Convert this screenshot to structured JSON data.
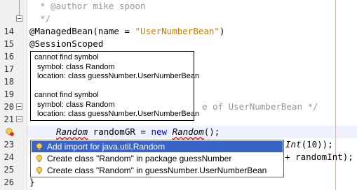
{
  "gutter": {
    "line_numbers": [
      "14",
      "15",
      "16",
      "17",
      "18",
      "19",
      "20",
      "21",
      "22",
      "23",
      "24",
      "25",
      "26"
    ]
  },
  "code": {
    "line_12": "* @author mike spoon",
    "line_13": "*/",
    "line_14_annotation": "@ManagedBean",
    "line_14_mid": "(name = ",
    "line_14_string": "\"UserNumberBean\"",
    "line_14_end": ")",
    "line_15": "@SessionScoped",
    "line_20_tail": "e of UserNumberBean */",
    "line_22_type": "Random",
    "line_22_var": " randomGR = ",
    "line_22_new": "new",
    "line_22_ctor": "Random",
    "line_22_end": "();",
    "line_23_tail_italic": "Int",
    "line_23_tail": "(10));",
    "line_24_tail": "+ randomInt);",
    "line_26": "}"
  },
  "tooltip": {
    "error1_title": "cannot find symbol",
    "error1_symbol": "symbol:   class Random",
    "error1_location": "location: class guessNumber.UserNumberBean",
    "error2_title": "cannot find symbol",
    "error2_symbol": "symbol:   class Random",
    "error2_location": "location: class guessNumber.UserNumberBean"
  },
  "hint_popup": {
    "items": [
      {
        "label": "Add import for java.util.Random"
      },
      {
        "label": "Create class \"Random\" in package guessNumber"
      },
      {
        "label": "Create class \"Random\" in guessNumber.UserNumberBean"
      }
    ]
  },
  "colors": {
    "selection": "#3a63c8",
    "string": "#ce7b00",
    "keyword": "#0000e6",
    "error": "#e00000"
  }
}
